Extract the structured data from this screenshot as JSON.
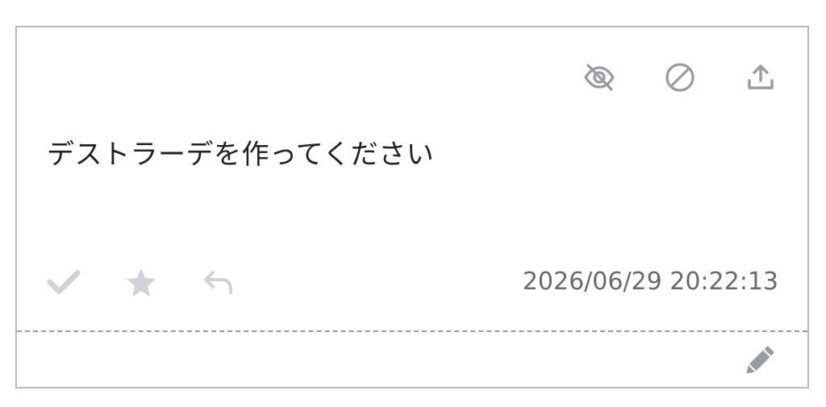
{
  "card": {
    "message": "デストラーデを作ってください",
    "timestamp": "2026/06/29 20:22:13"
  },
  "icons": {
    "top": [
      "eye-off-icon",
      "block-icon",
      "upload-icon"
    ],
    "bottom": [
      "check-icon",
      "star-icon",
      "reply-icon"
    ],
    "footer": [
      "pencil-icon"
    ]
  },
  "colors": {
    "border": "#b8b8c0",
    "top_icon": "#9a9aa2",
    "bottom_icon": "#d2d2d6",
    "text": "#222222",
    "timestamp": "#6a6a6a",
    "divider": "#9a9a9a",
    "edit_icon": "#9a9aa2"
  }
}
